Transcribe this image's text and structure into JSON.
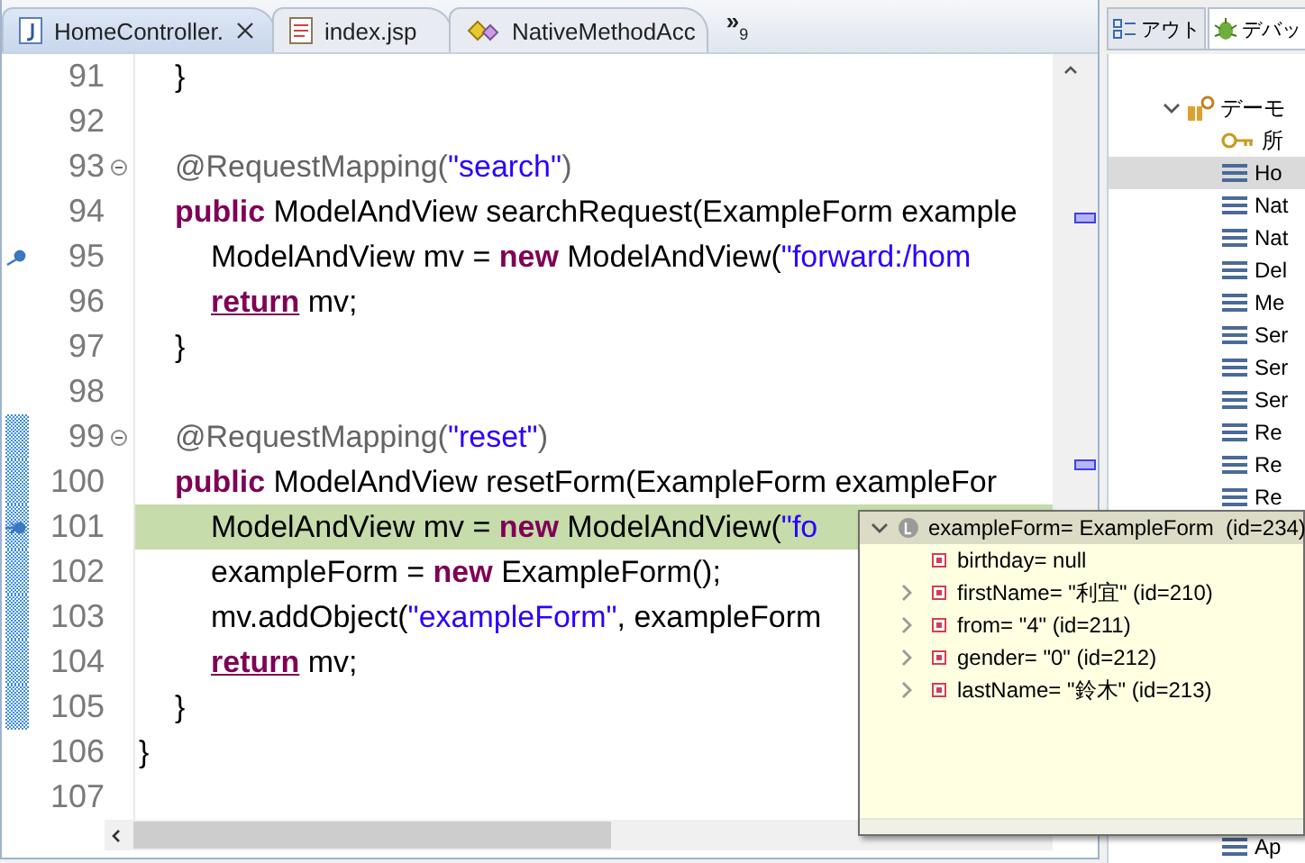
{
  "editor": {
    "tabs": [
      {
        "label": "HomeController.",
        "kind": "java",
        "selected": true,
        "closable": true
      },
      {
        "label": "index.jsp",
        "kind": "jsp",
        "selected": false,
        "closable": false
      },
      {
        "label": "NativeMethodAcc",
        "kind": "class",
        "selected": false,
        "closable": false
      }
    ],
    "overflow": {
      "symbol": "»",
      "count": "9"
    },
    "lines": [
      {
        "children": [
          {
            "number": "91",
            "fold": false,
            "breakpoint": false,
            "current": false,
            "changed": false,
            "tokens": [
              {
                "kind": "plain",
                "text": "}"
              }
            ]
          },
          {
            "number": "92",
            "fold": false,
            "breakpoint": false,
            "current": false,
            "changed": false
          },
          {
            "number": "93",
            "fold": true,
            "breakpoint": false,
            "current": false,
            "changed": false,
            "tokens": [
              {
                "kind": "annotation",
                "text": "@RequestMapping("
              },
              {
                "kind": "string",
                "text": "\"search\""
              },
              {
                "kind": "annotation",
                "text": ")"
              }
            ]
          },
          {
            "number": "94",
            "fold": false,
            "breakpoint": false,
            "current": false,
            "changed": false,
            "tokens": [
              {
                "kind": "keyword",
                "text": "public"
              },
              {
                "kind": "plain",
                "text": " ModelAndView searchRequest(ExampleForm example"
              }
            ],
            "children": [
              {
                "number": "95",
                "fold": false,
                "breakpoint": true,
                "current": false,
                "changed": false,
                "tokens": [
                  {
                    "kind": "plain",
                    "text": "ModelAndView mv = "
                  },
                  {
                    "kind": "keyword",
                    "text": "new"
                  },
                  {
                    "kind": "plain",
                    "text": " ModelAndView("
                  },
                  {
                    "kind": "string",
                    "text": "\"forward:/hom"
                  }
                ]
              },
              {
                "number": "96",
                "fold": false,
                "breakpoint": false,
                "current": false,
                "changed": false,
                "tokens": [
                  {
                    "kind": "return",
                    "text": "return"
                  },
                  {
                    "kind": "plain",
                    "text": " mv;"
                  }
                ]
              }
            ]
          },
          {
            "number": "97",
            "fold": false,
            "breakpoint": false,
            "current": false,
            "changed": false,
            "tokens": [
              {
                "kind": "plain",
                "text": "}"
              }
            ]
          },
          {
            "number": "98",
            "fold": false,
            "breakpoint": false,
            "current": false,
            "changed": false
          },
          {
            "number": "99",
            "fold": true,
            "breakpoint": false,
            "current": false,
            "changed": true,
            "tokens": [
              {
                "kind": "annotation",
                "text": "@RequestMapping("
              },
              {
                "kind": "string",
                "text": "\"reset\""
              },
              {
                "kind": "annotation",
                "text": ")"
              }
            ]
          },
          {
            "number": "100",
            "fold": false,
            "breakpoint": false,
            "current": false,
            "changed": true,
            "tokens": [
              {
                "kind": "keyword",
                "text": "public"
              },
              {
                "kind": "plain",
                "text": " ModelAndView resetForm(ExampleForm exampleFor"
              }
            ],
            "children": [
              {
                "number": "101",
                "fold": false,
                "breakpoint": true,
                "current": true,
                "changed": true,
                "tokens": [
                  {
                    "kind": "plain",
                    "text": "ModelAndView mv = "
                  },
                  {
                    "kind": "keyword",
                    "text": "new"
                  },
                  {
                    "kind": "plain",
                    "text": " ModelAndView("
                  },
                  {
                    "kind": "string",
                    "text": "\"fo"
                  }
                ]
              },
              {
                "number": "102",
                "fold": false,
                "breakpoint": false,
                "current": false,
                "changed": true,
                "tokens": [
                  {
                    "kind": "plain",
                    "text": "exampleForm = "
                  },
                  {
                    "kind": "keyword",
                    "text": "new"
                  },
                  {
                    "kind": "plain",
                    "text": " ExampleForm();"
                  }
                ]
              },
              {
                "number": "103",
                "fold": false,
                "breakpoint": false,
                "current": false,
                "changed": true,
                "tokens": [
                  {
                    "kind": "plain",
                    "text": "mv.addObject("
                  },
                  {
                    "kind": "string",
                    "text": "\"exampleForm\""
                  },
                  {
                    "kind": "plain",
                    "text": ", exampleForm"
                  }
                ]
              },
              {
                "number": "104",
                "fold": false,
                "breakpoint": false,
                "current": false,
                "changed": true,
                "tokens": [
                  {
                    "kind": "return",
                    "text": "return"
                  },
                  {
                    "kind": "plain",
                    "text": " mv;"
                  }
                ]
              }
            ]
          },
          {
            "number": "105",
            "fold": false,
            "breakpoint": false,
            "current": false,
            "changed": true,
            "tokens": [
              {
                "kind": "plain",
                "text": "}"
              }
            ]
          }
        ]
      },
      {
        "number": "106",
        "fold": false,
        "breakpoint": false,
        "current": false,
        "changed": false,
        "tokens": [
          {
            "kind": "plain",
            "text": "}"
          }
        ]
      },
      {
        "number": "107",
        "fold": false,
        "breakpoint": false,
        "current": false,
        "changed": false
      }
    ]
  },
  "side_panel": {
    "tabs": [
      {
        "label": "アウト",
        "kind": "outline",
        "selected": false
      },
      {
        "label": "デバッ",
        "kind": "debug",
        "selected": true
      }
    ],
    "tree": [
      {
        "label": "デーモ",
        "kind": "thread-group",
        "expanded": true,
        "selected": false,
        "children": [
          {
            "label": "所",
            "kind": "key",
            "selected": false
          },
          {
            "label": "Ho",
            "kind": "frame",
            "selected": true
          },
          {
            "label": "Nat",
            "kind": "frame",
            "selected": false
          },
          {
            "label": "Nat",
            "kind": "frame",
            "selected": false
          },
          {
            "label": "Del",
            "kind": "frame",
            "selected": false
          },
          {
            "label": "Me",
            "kind": "frame",
            "selected": false
          },
          {
            "label": "Ser",
            "kind": "frame",
            "selected": false
          },
          {
            "label": "Ser",
            "kind": "frame",
            "selected": false
          },
          {
            "label": "Ser",
            "kind": "frame",
            "selected": false
          },
          {
            "label": "Re",
            "kind": "frame",
            "selected": false
          },
          {
            "label": "Re",
            "kind": "frame",
            "selected": false
          },
          {
            "label": "Re",
            "kind": "frame",
            "selected": false
          },
          {
            "label": "Ap",
            "kind": "frame",
            "selected": false
          }
        ]
      }
    ]
  },
  "inspect_popup": {
    "root": {
      "label": "exampleForm= ExampleForm  (id=234)",
      "expanded": true
    },
    "fields": [
      {
        "label": "birthday= null",
        "expandable": false
      },
      {
        "label": "firstName= \"利宜\" (id=210)",
        "expandable": true
      },
      {
        "label": "from= \"4\" (id=211)",
        "expandable": true
      },
      {
        "label": "gender= \"0\" (id=212)",
        "expandable": true
      },
      {
        "label": "lastName= \"鈴木\" (id=213)",
        "expandable": true
      }
    ]
  }
}
